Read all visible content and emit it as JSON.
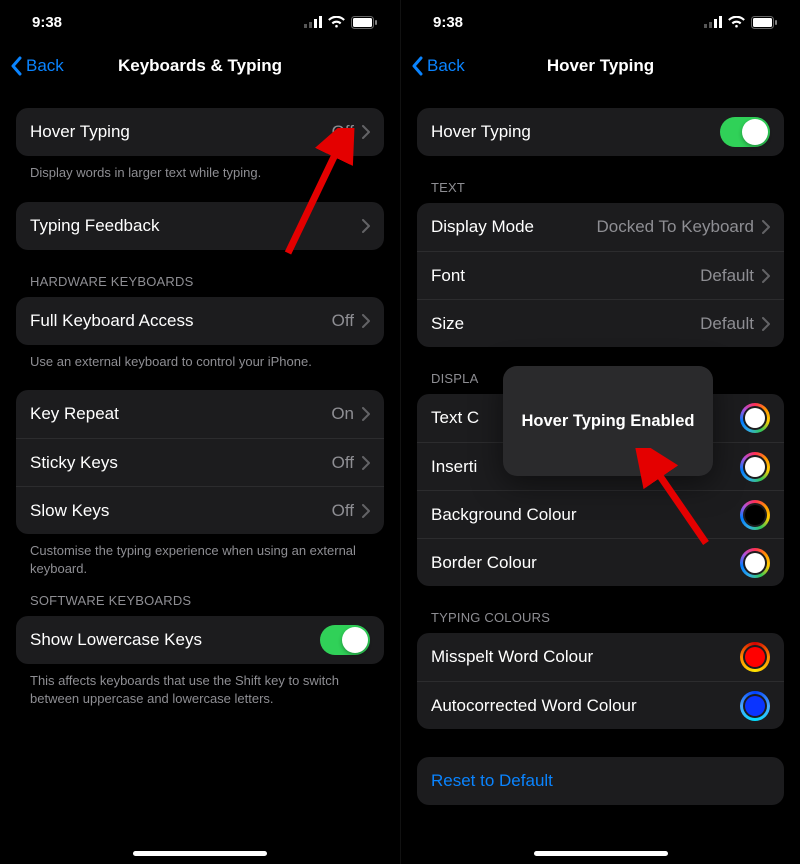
{
  "status": {
    "time": "9:38"
  },
  "nav": {
    "back": "Back"
  },
  "left": {
    "title": "Keyboards & Typing",
    "hover_typing": {
      "label": "Hover Typing",
      "value": "Off",
      "footer": "Display words in larger text while typing."
    },
    "typing_feedback": {
      "label": "Typing Feedback"
    },
    "hw_header": "HARDWARE KEYBOARDS",
    "full_kb": {
      "label": "Full Keyboard Access",
      "value": "Off",
      "footer": "Use an external keyboard to control your iPhone."
    },
    "key_repeat": {
      "label": "Key Repeat",
      "value": "On"
    },
    "sticky_keys": {
      "label": "Sticky Keys",
      "value": "Off"
    },
    "slow_keys": {
      "label": "Slow Keys",
      "value": "Off"
    },
    "hw_footer": "Customise the typing experience when using an external keyboard.",
    "sw_header": "SOFTWARE KEYBOARDS",
    "show_lc": {
      "label": "Show Lowercase Keys",
      "footer": "This affects keyboards that use the Shift key to switch between uppercase and lowercase letters."
    }
  },
  "right": {
    "title": "Hover Typing",
    "hover_typing": {
      "label": "Hover Typing"
    },
    "text_header": "TEXT",
    "display_mode": {
      "label": "Display Mode",
      "value": "Docked To Keyboard"
    },
    "font": {
      "label": "Font",
      "value": "Default"
    },
    "size": {
      "label": "Size",
      "value": "Default"
    },
    "display_colours_header": "DISPLAY COLOURS",
    "text_colour": {
      "label": "Text Colour"
    },
    "insertion_colour": {
      "label": "Insertion Point Colour"
    },
    "background_colour": {
      "label": "Background Colour"
    },
    "border_colour": {
      "label": "Border Colour"
    },
    "typing_colours_header": "TYPING COLOURS",
    "misspelt": {
      "label": "Misspelt Word Colour"
    },
    "autocorrected": {
      "label": "Autocorrected Word Colour"
    },
    "reset": "Reset to Default",
    "toast": "Hover Typing Enabled",
    "partial_prefix": {
      "text": "Text C",
      "inserti": "Inserti",
      "display": "DISPLA"
    }
  },
  "colours": {
    "text": "#ffffff",
    "insertion": "#ffffff",
    "background": "#000000",
    "border": "#ffffff",
    "misspelt": "#ff0000",
    "autocorrected": "#0a34ff"
  }
}
